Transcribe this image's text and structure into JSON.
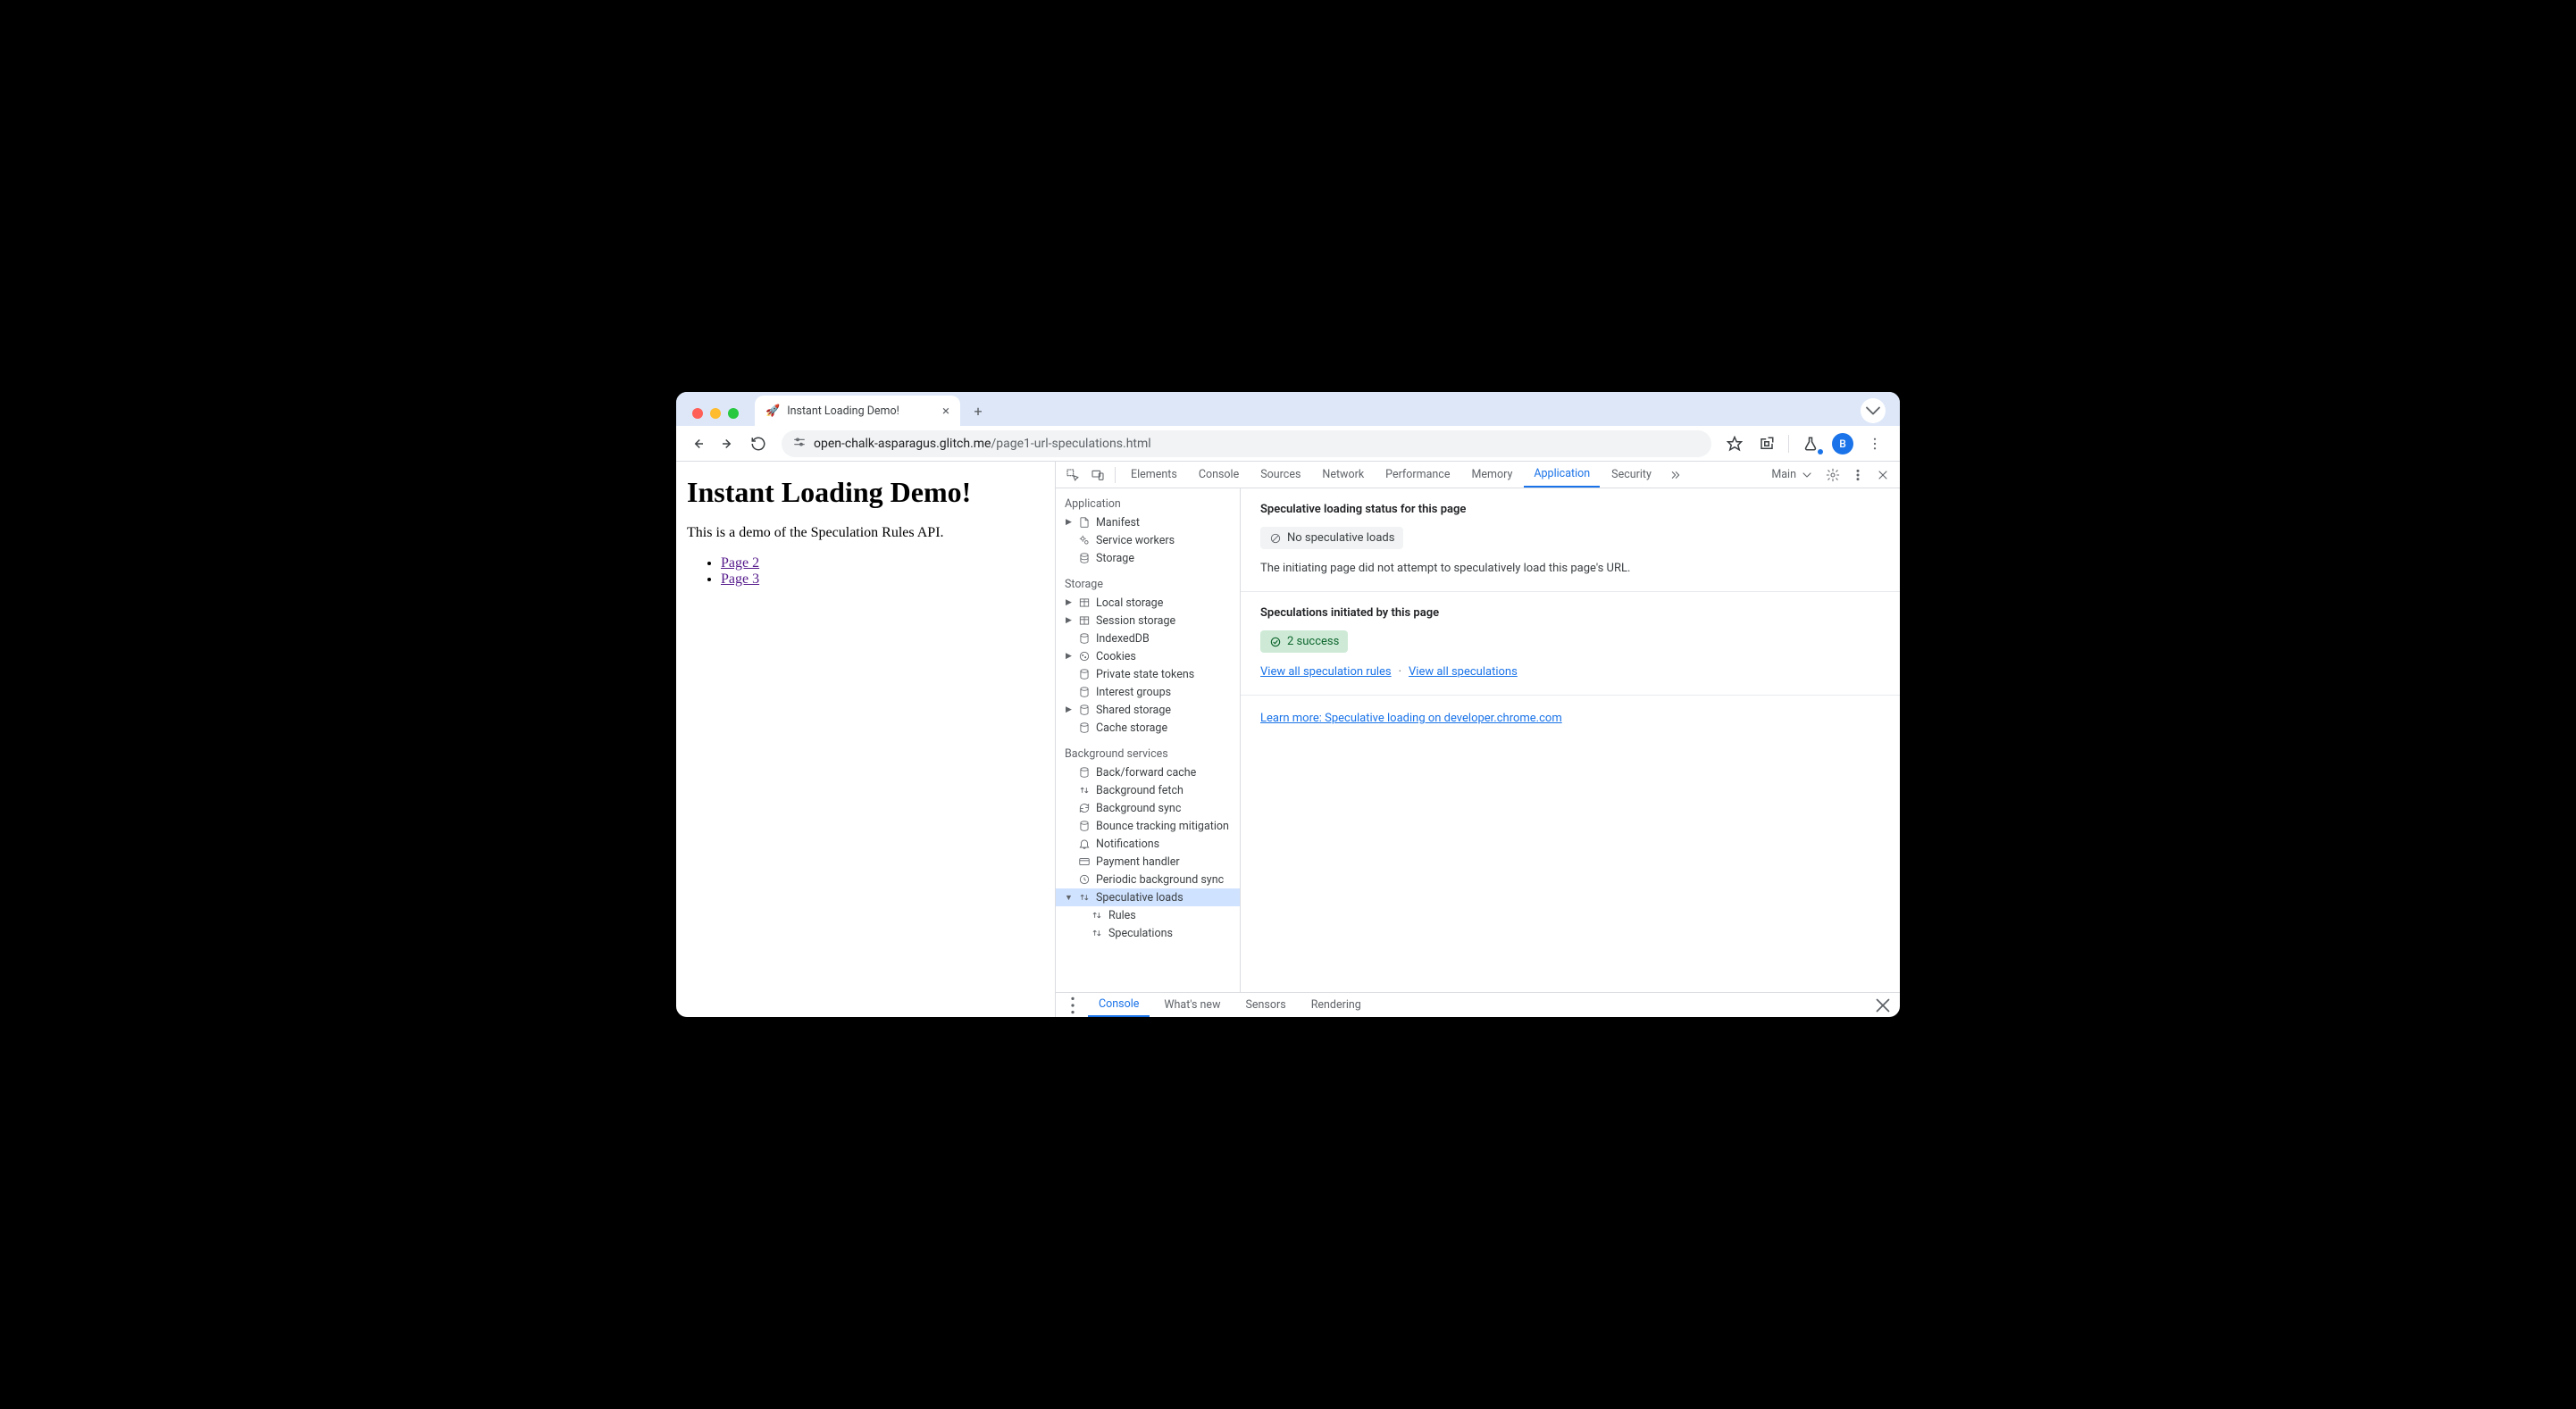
{
  "browser": {
    "tab_title": "Instant Loading Demo!",
    "favicon": "🚀",
    "url_host": "open-chalk-asparagus.glitch.me",
    "url_path": "/page1-url-speculations.html",
    "avatar_letter": "B"
  },
  "page": {
    "heading": "Instant Loading Demo!",
    "intro": "This is a demo of the Speculation Rules API.",
    "links": [
      "Page 2",
      "Page 3"
    ]
  },
  "devtools": {
    "tabs": [
      "Elements",
      "Console",
      "Sources",
      "Network",
      "Performance",
      "Memory",
      "Application",
      "Security"
    ],
    "active_tab": "Application",
    "frame": "Main",
    "sidebar": {
      "sections": [
        {
          "title": "Application",
          "items": [
            {
              "label": "Manifest",
              "icon": "file",
              "arrow": true
            },
            {
              "label": "Service workers",
              "icon": "gears"
            },
            {
              "label": "Storage",
              "icon": "db"
            }
          ]
        },
        {
          "title": "Storage",
          "items": [
            {
              "label": "Local storage",
              "icon": "grid",
              "arrow": true
            },
            {
              "label": "Session storage",
              "icon": "grid",
              "arrow": true
            },
            {
              "label": "IndexedDB",
              "icon": "db"
            },
            {
              "label": "Cookies",
              "icon": "cookie",
              "arrow": true
            },
            {
              "label": "Private state tokens",
              "icon": "db"
            },
            {
              "label": "Interest groups",
              "icon": "db"
            },
            {
              "label": "Shared storage",
              "icon": "db",
              "arrow": true
            },
            {
              "label": "Cache storage",
              "icon": "db"
            }
          ]
        },
        {
          "title": "Background services",
          "items": [
            {
              "label": "Back/forward cache",
              "icon": "db"
            },
            {
              "label": "Background fetch",
              "icon": "updown"
            },
            {
              "label": "Background sync",
              "icon": "sync"
            },
            {
              "label": "Bounce tracking mitigation",
              "icon": "db"
            },
            {
              "label": "Notifications",
              "icon": "bell"
            },
            {
              "label": "Payment handler",
              "icon": "card"
            },
            {
              "label": "Periodic background sync",
              "icon": "clock"
            },
            {
              "label": "Speculative loads",
              "icon": "updown",
              "arrow": true,
              "expanded": true,
              "selected": true
            },
            {
              "label": "Rules",
              "icon": "updown",
              "child": true
            },
            {
              "label": "Speculations",
              "icon": "updown",
              "child": true
            }
          ]
        }
      ]
    },
    "main": {
      "status_heading": "Speculative loading status for this page",
      "status_badge": "No speculative loads",
      "status_text": "The initiating page did not attempt to speculatively load this page's URL.",
      "init_heading": "Speculations initiated by this page",
      "init_badge": "2 success",
      "link_rules": "View all speculation rules",
      "link_specs": "View all speculations",
      "learn_more": "Learn more: Speculative loading on developer.chrome.com"
    },
    "drawer": {
      "tabs": [
        "Console",
        "What's new",
        "Sensors",
        "Rendering"
      ],
      "active": "Console"
    }
  }
}
